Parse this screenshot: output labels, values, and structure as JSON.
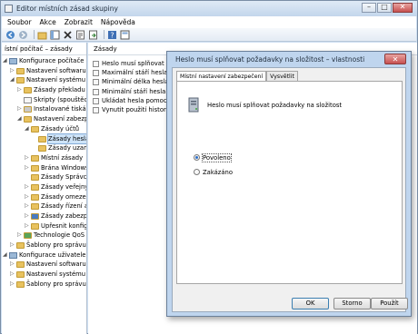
{
  "window": {
    "title": "Editor místních zásad skupiny"
  },
  "menu": [
    "Soubor",
    "Akce",
    "Zobrazit",
    "Nápověda"
  ],
  "tree": {
    "header": "ístní počítač – zásady",
    "items": [
      {
        "label": "Konfigurace počítače",
        "icon": "computer-config-icon",
        "depth": 0,
        "expander": "◢"
      },
      {
        "label": "Nastavení softwaru",
        "icon": "folder-icon",
        "depth": 1,
        "expander": "▷"
      },
      {
        "label": "Nastavení systému Wind",
        "icon": "folder-icon",
        "depth": 1,
        "expander": "◢"
      },
      {
        "label": "Zásady překladu IP a",
        "icon": "folder-icon",
        "depth": 2,
        "expander": "▷"
      },
      {
        "label": "Skripty (spouštěcí ne",
        "icon": "script-icon",
        "depth": 2,
        "expander": ""
      },
      {
        "label": "Instalované tiskárny",
        "icon": "printer-icon",
        "depth": 2,
        "expander": "▷"
      },
      {
        "label": "Nastavení zabezpeč",
        "icon": "folder-icon",
        "depth": 2,
        "expander": "◢"
      },
      {
        "label": "Zásady účtů",
        "icon": "folder-icon",
        "depth": 3,
        "expander": "◢"
      },
      {
        "label": "Zásady hesla",
        "icon": "folder-icon",
        "depth": 4,
        "expander": "",
        "selected": true
      },
      {
        "label": "Zásady uzam",
        "icon": "folder-icon",
        "depth": 4,
        "expander": ""
      },
      {
        "label": "Místní zásady",
        "icon": "folder-icon",
        "depth": 3,
        "expander": "▷"
      },
      {
        "label": "Brána Windows I",
        "icon": "folder-icon",
        "depth": 3,
        "expander": "▷"
      },
      {
        "label": "Zásady Správce s",
        "icon": "folder-icon",
        "depth": 3,
        "expander": ""
      },
      {
        "label": "Zásady veřejných",
        "icon": "folder-icon",
        "depth": 3,
        "expander": "▷"
      },
      {
        "label": "Zásady omezení",
        "icon": "folder-icon",
        "depth": 3,
        "expander": "▷"
      },
      {
        "label": "Zásady řízení apl",
        "icon": "folder-icon",
        "depth": 3,
        "expander": "▷"
      },
      {
        "label": "Zásady zabezpeč",
        "icon": "shield-icon",
        "depth": 3,
        "expander": "▷"
      },
      {
        "label": "Upřesnit konfigu",
        "icon": "folder-icon",
        "depth": 3,
        "expander": "▷"
      },
      {
        "label": "Technologie QoS sp",
        "icon": "chart-icon",
        "depth": 2,
        "expander": "▷"
      },
      {
        "label": "Šablony pro správu",
        "icon": "folder-icon",
        "depth": 1,
        "expander": "▷"
      },
      {
        "label": "Konfigurace uživatele",
        "icon": "user-config-icon",
        "depth": 0,
        "expander": "◢"
      },
      {
        "label": "Nastavení softwaru",
        "icon": "folder-icon",
        "depth": 1,
        "expander": "▷"
      },
      {
        "label": "Nastavení systému Wind",
        "icon": "folder-icon",
        "depth": 1,
        "expander": "▷"
      },
      {
        "label": "Šablony pro správu",
        "icon": "folder-icon",
        "depth": 1,
        "expander": "▷"
      }
    ]
  },
  "list": {
    "header": "Zásady",
    "items": [
      "Heslo musí splňovat po",
      "Maximální stáří hesla",
      "Minimální délka hesla",
      "Minimální stáří hesla",
      "Ukládat hesla pomocí re",
      "Vynutit použití historie I"
    ]
  },
  "dialog": {
    "title": "Heslo musí splňovat požadavky na složitost – vlastnosti",
    "tabs": [
      "Místní nastavení zabezpečení",
      "Vysvětlit"
    ],
    "policy_name": "Heslo musí splňovat požadavky na složitost",
    "options": [
      {
        "label": "Povoleno",
        "checked": true
      },
      {
        "label": "Zakázáno",
        "checked": false
      }
    ],
    "buttons": {
      "ok": "OK",
      "cancel": "Storno",
      "apply": "Použít"
    }
  }
}
